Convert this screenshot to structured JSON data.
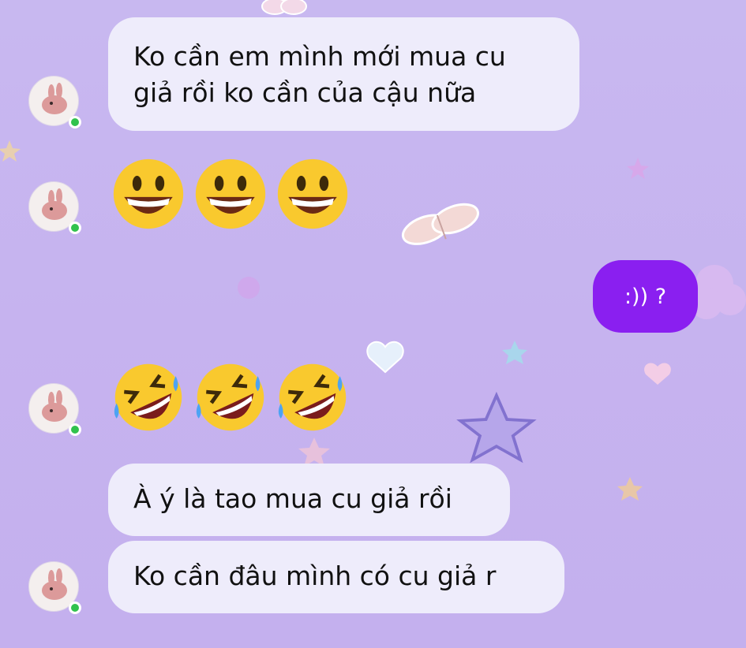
{
  "messages": [
    {
      "sender": "contact",
      "type": "text",
      "lines": [
        "Ko cần em mình mới mua cu",
        "giả rồi ko cần của cậu nữa"
      ]
    },
    {
      "sender": "contact",
      "type": "emoji",
      "emoji": "grinning-face",
      "count": 3
    },
    {
      "sender": "me",
      "type": "text",
      "text": ":)) ?"
    },
    {
      "sender": "contact",
      "type": "emoji",
      "emoji": "rolling-on-floor-laughing",
      "count": 3
    },
    {
      "sender": "contact",
      "type": "text",
      "text": "À ý là tao mua cu giả rồi"
    },
    {
      "sender": "contact",
      "type": "text",
      "text": "Ko cần đâu mình có cu giả r"
    }
  ],
  "colors": {
    "background": "#c6b3ef",
    "incoming_bubble": "#eeecfb",
    "outgoing_bubble": "#8a1ff0",
    "online_indicator": "#31c24d"
  },
  "icons": [
    "contact-avatar-icon",
    "online-indicator-icon",
    "butterfly-sticker",
    "star-sticker",
    "heart-sticker",
    "flower-sticker"
  ]
}
